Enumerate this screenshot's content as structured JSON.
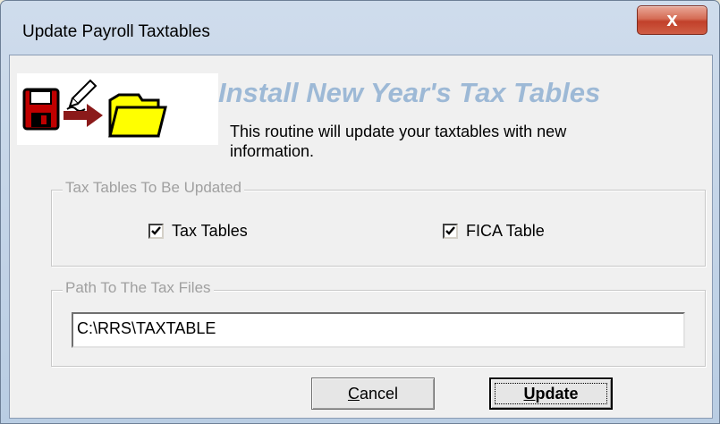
{
  "window": {
    "title": "Update Payroll Taxtables",
    "close_glyph": "x"
  },
  "banner": {
    "heading": "Install New Year's Tax Tables",
    "description": "This routine will update your taxtables with new information.",
    "icons": [
      "floppy-disk-icon",
      "pencil-icon",
      "arrow-right-icon",
      "folder-icon"
    ]
  },
  "tables_group": {
    "legend": "Tax Tables To Be Updated",
    "tax_tables": {
      "label": "Tax Tables",
      "checked": true
    },
    "fica_table": {
      "label": "FICA Table",
      "checked": true
    }
  },
  "path_group": {
    "legend": "Path To The Tax Files",
    "value": "C:\\RRS\\TAXTABLE"
  },
  "buttons": {
    "cancel": {
      "label_first": "C",
      "label_rest": "ancel"
    },
    "update": {
      "label_first": "U",
      "label_rest": "pdate"
    }
  },
  "colors": {
    "heading": "#9db9d6",
    "client_bg": "#f0f0f0",
    "close_button": "#c9503a"
  }
}
